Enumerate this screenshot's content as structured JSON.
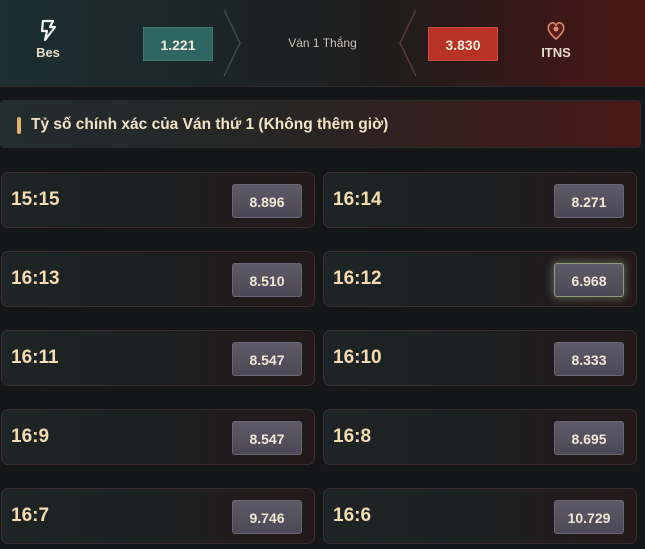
{
  "match": {
    "team_a": {
      "name": "Bes",
      "odds": "1.221"
    },
    "team_b": {
      "name": "ITNS",
      "odds": "3.830"
    },
    "market": "Ván 1 Thắng"
  },
  "section": {
    "title": "Tỷ số chính xác của Ván thứ 1 (Không thêm giờ)"
  },
  "scores": [
    {
      "score": "15:15",
      "odds": "8.896",
      "highlighted": false
    },
    {
      "score": "16:14",
      "odds": "8.271",
      "highlighted": false
    },
    {
      "score": "16:13",
      "odds": "8.510",
      "highlighted": false
    },
    {
      "score": "16:12",
      "odds": "6.968",
      "highlighted": true
    },
    {
      "score": "16:11",
      "odds": "8.547",
      "highlighted": false
    },
    {
      "score": "16:10",
      "odds": "8.333",
      "highlighted": false
    },
    {
      "score": "16:9",
      "odds": "8.547",
      "highlighted": false
    },
    {
      "score": "16:8",
      "odds": "8.695",
      "highlighted": false
    },
    {
      "score": "16:7",
      "odds": "9.746",
      "highlighted": false
    },
    {
      "score": "16:6",
      "odds": "10.729",
      "highlighted": false
    }
  ],
  "colors": {
    "accent": "#e6b36a",
    "team_a_odds_bg": "#2e6461",
    "team_b_odds_bg": "#b83226",
    "price_bg": "#5d5a68"
  },
  "icons": {
    "team_a_logo": "bes-logo-icon",
    "team_b_logo": "itns-logo-icon"
  }
}
